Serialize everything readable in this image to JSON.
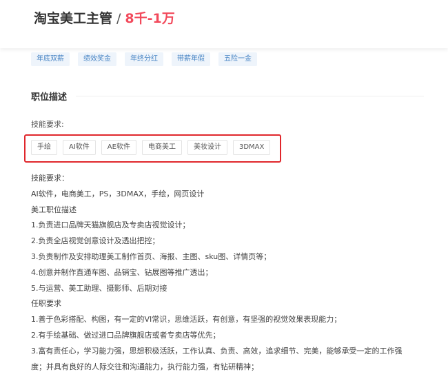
{
  "job": {
    "title": "淘宝美工主管",
    "separator": "/",
    "salary": "8千-1万"
  },
  "benefits": [
    "年底双薪",
    "绩效奖金",
    "年终分红",
    "带薪年假",
    "五险一金"
  ],
  "section": {
    "title": "职位描述"
  },
  "skills": {
    "label": "技能要求:",
    "tags": [
      "手绘",
      "AI软件",
      "AE软件",
      "电商美工",
      "美妆设计",
      "3DMAX"
    ]
  },
  "description": [
    "技能要求：",
    "AI软件，电商美工，PS，3DMAX，手绘，网页设计",
    "美工职位描述",
    "1.负责进口品牌天猫旗舰店及专卖店视觉设计；",
    "2.负责全店视觉创意设计及透出把控；",
    "3.负责制作及安排助理美工制作首页、海报、主图、sku图、详情页等；",
    "4.创意并制作直通车图、品销宝、钻展图等推广透出；",
    "5.与运营、美工助理、摄影师、后期对接",
    "任职要求",
    "1.善于色彩搭配、构图，有一定的VI常识，思维活跃，有创意，有坚强的视觉效果表现能力；",
    "2.有手绘基础、做过进口品牌旗舰店或者专卖店等优先；",
    "3.富有责任心，学习能力强，思想积极活跃，工作认真、负责、高效，追求细节、完美，能够承受一定的工作强",
    "度；并具有良好的人际交往和沟通能力，执行能力强，有钻研精神；"
  ],
  "colors": {
    "salary": "#f2495b",
    "benefit_text": "#4a86c5",
    "benefit_bg": "#eef4fb",
    "highlight_box": "#e0262b"
  }
}
